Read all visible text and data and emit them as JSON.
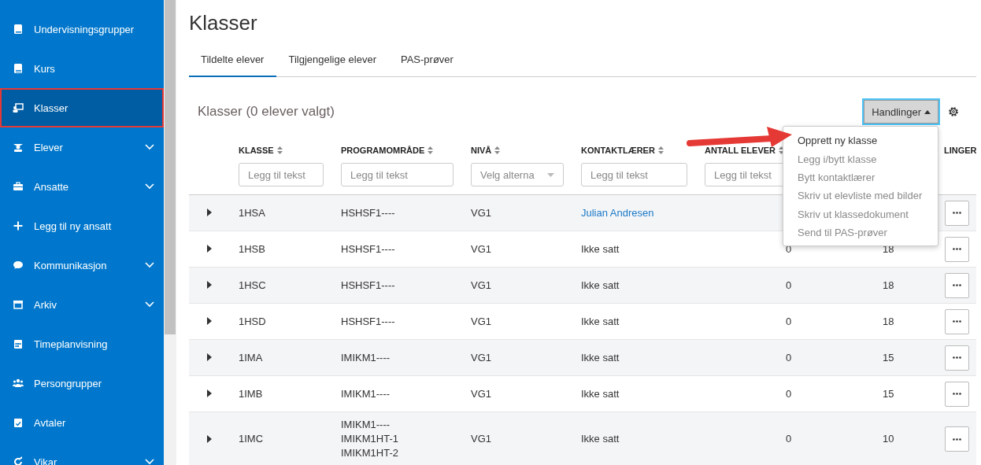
{
  "sidebar": {
    "items": [
      {
        "label": "Undervisningsgrupper",
        "selected": false,
        "expandable": false,
        "highlighted": false
      },
      {
        "label": "Kurs",
        "selected": false,
        "expandable": false,
        "highlighted": false
      },
      {
        "label": "Klasser",
        "selected": true,
        "expandable": false,
        "highlighted": true
      },
      {
        "label": "Elever",
        "selected": false,
        "expandable": true,
        "highlighted": false
      },
      {
        "label": "Ansatte",
        "selected": false,
        "expandable": true,
        "highlighted": false
      },
      {
        "label": "Legg til ny ansatt",
        "selected": false,
        "expandable": false,
        "highlighted": false
      },
      {
        "label": "Kommunikasjon",
        "selected": false,
        "expandable": true,
        "highlighted": false
      },
      {
        "label": "Arkiv",
        "selected": false,
        "expandable": true,
        "highlighted": false
      },
      {
        "label": "Timeplanvisning",
        "selected": false,
        "expandable": false,
        "highlighted": false
      },
      {
        "label": "Persongrupper",
        "selected": false,
        "expandable": false,
        "highlighted": false
      },
      {
        "label": "Avtaler",
        "selected": false,
        "expandable": false,
        "highlighted": false
      },
      {
        "label": "Vikar",
        "selected": false,
        "expandable": true,
        "highlighted": false
      }
    ]
  },
  "page": {
    "title": "Klasser",
    "tabs": [
      {
        "label": "Tildelte elever",
        "selected": true
      },
      {
        "label": "Tilgjengelige elever",
        "selected": false
      },
      {
        "label": "PAS-prøver",
        "selected": false
      }
    ],
    "section_title": "Klasser (0 elever valgt)",
    "actions_button": {
      "label": "Handlinger",
      "expanded": true
    },
    "actions_menu": [
      {
        "label": "Opprett ny klasse",
        "disabled": false
      },
      {
        "label": "Legg i/bytt klasse",
        "disabled": true
      },
      {
        "label": "Bytt kontaktlærer",
        "disabled": true
      },
      {
        "label": "Skriv ut elevliste med bilder",
        "disabled": true
      },
      {
        "label": "Skriv ut klassedokument",
        "disabled": true
      },
      {
        "label": "Send til PAS-prøver",
        "disabled": true
      }
    ],
    "callout_arrow": true,
    "table": {
      "columns": [
        {
          "label": "KLASSE",
          "sortable": true,
          "filter": {
            "kind": "text",
            "placeholder": "Legg til tekst"
          }
        },
        {
          "label": "PROGRAMOMRÅDE",
          "sortable": true,
          "filter": {
            "kind": "text",
            "placeholder": "Legg til tekst"
          }
        },
        {
          "label": "NIVÅ",
          "sortable": true,
          "filter": {
            "kind": "select",
            "placeholder": "Velg alterna"
          }
        },
        {
          "label": "KONTAKTLÆRER",
          "sortable": true,
          "filter": {
            "kind": "text",
            "placeholder": "Legg til tekst"
          }
        },
        {
          "label": "ANTALL ELEVER",
          "sortable": true,
          "filter": {
            "kind": "text",
            "placeholder": "Legg til tekst"
          }
        },
        {
          "label": "LINGER",
          "sortable": false
        }
      ],
      "rows": [
        {
          "klasse": "1HSA",
          "programomrade": [
            "HSHSF1----"
          ],
          "niva": "VG1",
          "kontaktlaerer": {
            "text": "Julian Andresen",
            "link": true
          }
        },
        {
          "klasse": "1HSB",
          "programomrade": [
            "HSHSF1----"
          ],
          "niva": "VG1",
          "kontaktlaerer": {
            "text": "Ikke satt",
            "link": false
          },
          "antall_elever": "0",
          "column_7": "18"
        },
        {
          "klasse": "1HSC",
          "programomrade": [
            "HSHSF1----"
          ],
          "niva": "VG1",
          "kontaktlaerer": {
            "text": "Ikke satt",
            "link": false
          },
          "antall_elever": "0",
          "column_7": "18"
        },
        {
          "klasse": "1HSD",
          "programomrade": [
            "HSHSF1----"
          ],
          "niva": "VG1",
          "kontaktlaerer": {
            "text": "Ikke satt",
            "link": false
          },
          "antall_elever": "0",
          "column_7": "18"
        },
        {
          "klasse": "1IMA",
          "programomrade": [
            "IMIKM1----"
          ],
          "niva": "VG1",
          "kontaktlaerer": {
            "text": "Ikke satt",
            "link": false
          },
          "antall_elever": "0",
          "column_7": "15"
        },
        {
          "klasse": "1IMB",
          "programomrade": [
            "IMIKM1----"
          ],
          "niva": "VG1",
          "kontaktlaerer": {
            "text": "Ikke satt",
            "link": false
          },
          "antall_elever": "0",
          "column_7": "15"
        },
        {
          "klasse": "1IMC",
          "programomrade": [
            "IMIKM1----",
            "IMIKM1HT-1",
            "IMIKM1HT-2"
          ],
          "niva": "VG1",
          "kontaktlaerer": {
            "text": "Ikke satt",
            "link": false
          },
          "antall_elever": "0",
          "column_7": "10"
        }
      ]
    }
  }
}
